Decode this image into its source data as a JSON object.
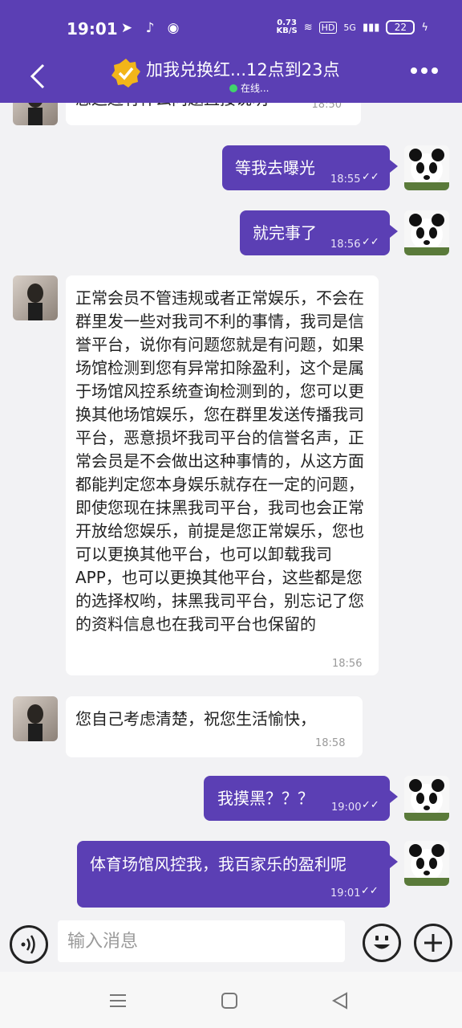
{
  "status": {
    "time": "19:01",
    "speed_value": "0.73",
    "speed_unit": "KB/S",
    "hd": "HD",
    "signal": "5G",
    "battery": "22"
  },
  "header": {
    "title": "加我兑换红...12点到23点",
    "online": "在线..."
  },
  "messages": [
    {
      "side": "in",
      "text": "您这边有什么问题直接说明",
      "time": "18:50"
    },
    {
      "side": "out",
      "text": "等我去曝光",
      "time": "18:55"
    },
    {
      "side": "out",
      "text": "就完事了",
      "time": "18:56"
    },
    {
      "side": "in",
      "text": "正常会员不管违规或者正常娱乐，不会在群里发一些对我司不利的事情，我司是信誉平台，说你有问题您就是有问题，如果场馆检测到您有异常扣除盈利，这个是属于场馆风控系统查询检测到的，您可以更换其他场馆娱乐，您在群里发送传播我司平台，恶意损坏我司平台的信誉名声，正常会员是不会做出这种事情的，从这方面都能判定您本身娱乐就存在一定的问题，即使您现在抹黑我司平台，我司也会正常开放给您娱乐，前提是您正常娱乐，您也可以更换其他平台，也可以卸载我司APP，也可以更换其他平台，这些都是您的选择权哟，抹黑我司平台，别忘记了您的资料信息也在我司平台也保留的",
      "time": "18:56"
    },
    {
      "side": "in",
      "text": "您自己考虑清楚，祝您生活愉快，",
      "time": "18:58"
    },
    {
      "side": "out",
      "text": "我摸黑？？？",
      "time": "19:00"
    },
    {
      "side": "out",
      "text": "体育场馆风控我，我百家乐的盈利呢",
      "time": "19:01"
    }
  ],
  "input": {
    "placeholder": "输入消息"
  },
  "colors": {
    "accent": "#5b3fb4",
    "background": "#f2f2f4",
    "online": "#41d36b"
  },
  "icons": [
    "back-icon",
    "verified-badge-icon",
    "more-icon",
    "voice-icon",
    "emoji-icon",
    "plus-icon",
    "menu-icon",
    "home-icon",
    "back-triangle-icon"
  ]
}
